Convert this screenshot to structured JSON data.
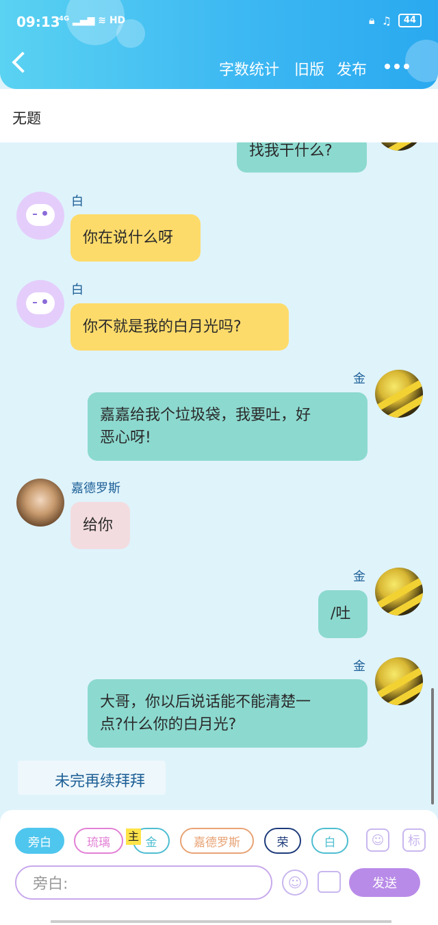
{
  "status_bar": {
    "time": "09:13",
    "network": "4G",
    "network2": "HD",
    "battery": "44"
  },
  "header": {
    "word_count": "字数统计",
    "old_version": "旧版",
    "publish": "发布"
  },
  "title": "无题",
  "messages": [
    {
      "speaker": "",
      "text": "找我干什么?"
    },
    {
      "speaker": "白",
      "text": "你在说什么呀"
    },
    {
      "speaker": "白",
      "text": "你不就是我的白月光吗?"
    },
    {
      "speaker": "金",
      "text_line1": "嘉嘉给我个垃圾袋，我要吐，好",
      "text_line2": "恶心呀!"
    },
    {
      "speaker": "嘉德罗斯",
      "text": "给你"
    },
    {
      "speaker": "金",
      "text": "/吐"
    },
    {
      "speaker": "金",
      "text_line1": "大哥，你以后说话能不能清楚一",
      "text_line2": "点?什么你的白月光?"
    }
  ],
  "note": "未完再续拜拜",
  "roles": {
    "narrator": "旁白",
    "liuli": "琉璃",
    "master_badge": "主",
    "jin": "金",
    "jiadeluosi": "嘉德罗斯",
    "rong": "荣",
    "bai": "白"
  },
  "tools": {
    "mark": "标"
  },
  "input": {
    "placeholder": "旁白:"
  },
  "send_label": "发送"
}
